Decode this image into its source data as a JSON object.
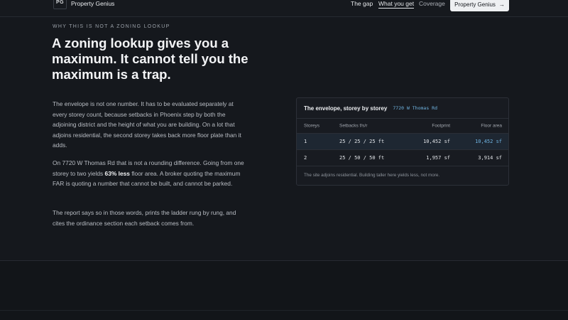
{
  "nav": {
    "logo_text": "PG",
    "brand": "Property Genius",
    "links": [
      {
        "label": "The gap"
      },
      {
        "label": "What you get"
      },
      {
        "label": "Coverage"
      }
    ],
    "cta_label": "Property Genius",
    "cta_arrow": "→"
  },
  "section": {
    "eyebrow": "WHY THIS IS NOT A ZONING LOOKUP",
    "headline": "A zoning lookup gives you a maximum. It cannot tell you the maximum is a trap.",
    "para1": "The envelope is not one number. It has to be evaluated separately at every storey count, because setbacks in Phoenix step by both the adjoining district and the height of what you are building. On a lot that adjoins residential, the second storey takes back more floor plate than it adds.",
    "para2_before": "On 7720 W Thomas Rd that is not a rounding difference. Going from one storey to two yields ",
    "para2_bold": "63% less",
    "para2_after": " floor area. A broker quoting the maximum FAR is quoting a number that cannot be built, and cannot be parked.",
    "para3": "The report says so in those words, prints the ladder rung by rung, and cites the ordinance section each setback comes from."
  },
  "card": {
    "title": "The envelope, storey by storey",
    "address": "7720 W Thomas Rd",
    "columns": [
      "Storeys",
      "Setbacks f/s/r",
      "Footprint",
      "Floor area"
    ],
    "rows": [
      {
        "storeys": "1",
        "setbacks": "25 / 25 / 25 ft",
        "footprint": "10,452 sf",
        "floor_area": "10,452 sf"
      },
      {
        "storeys": "2",
        "setbacks": "25 / 50 / 50 ft",
        "footprint": "1,957 sf",
        "floor_area": "3,914 sf"
      }
    ],
    "note": "The site adjoins residential. Building taller here yields less, not more."
  },
  "colors": {
    "background": "#15181d",
    "accent": "#6fb3e0",
    "cta_bg": "#eef0f2"
  }
}
